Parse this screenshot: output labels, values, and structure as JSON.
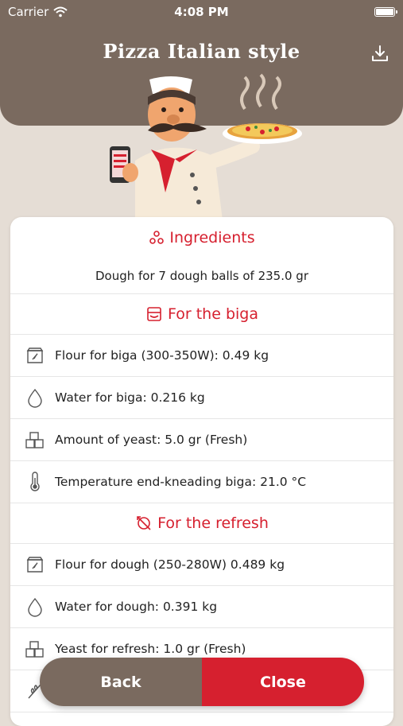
{
  "status_bar": {
    "carrier": "Carrier",
    "time": "4:08 PM"
  },
  "header": {
    "title": "Pizza Italian style"
  },
  "ingredients": {
    "heading": "Ingredients",
    "dough_summary": "Dough for 7 dough balls of 235.0 gr"
  },
  "biga": {
    "heading": "For the biga",
    "rows": [
      {
        "icon": "flour-bag-icon",
        "text": "Flour for biga (300-350W): 0.49 kg"
      },
      {
        "icon": "water-drop-icon",
        "text": "Water for biga: 0.216 kg"
      },
      {
        "icon": "yeast-cubes-icon",
        "text": "Amount of yeast: 5.0 gr (Fresh)"
      },
      {
        "icon": "thermometer-icon",
        "text": "Temperature end-kneading biga: 21.0 °C"
      }
    ]
  },
  "refresh": {
    "heading": "For the refresh",
    "rows": [
      {
        "icon": "flour-bag-icon",
        "text": "Flour for dough (250-280W) 0.489 kg"
      },
      {
        "icon": "water-drop-icon",
        "text": "Water for dough: 0.391 kg"
      },
      {
        "icon": "yeast-cubes-icon",
        "text": "Yeast for refresh: 1.0 gr (Fresh)"
      }
    ]
  },
  "buttons": {
    "back": "Back",
    "close": "Close"
  },
  "colors": {
    "brown": "#7a6a5f",
    "red": "#d6202f",
    "background": "#e5ddd5"
  }
}
